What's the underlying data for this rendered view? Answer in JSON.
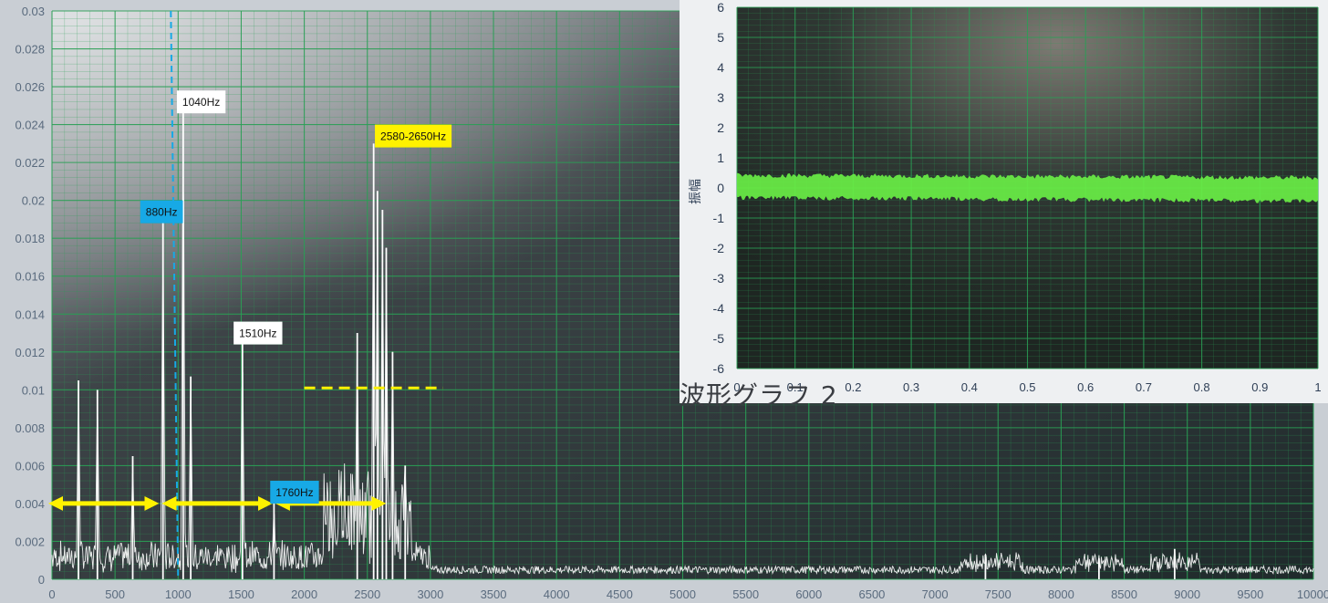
{
  "chart_data": [
    {
      "type": "line",
      "title": "",
      "xlabel": "",
      "ylabel": "",
      "xlim": [
        0,
        10000
      ],
      "ylim": [
        0,
        0.03
      ],
      "grid": true,
      "x_ticks": [
        "0",
        "500",
        "1000",
        "1500",
        "2000",
        "2500",
        "3000",
        "3500",
        "4000",
        "4500",
        "5000",
        "5500",
        "6000",
        "6500",
        "7000",
        "7500",
        "8000",
        "8500",
        "9000",
        "9500",
        "10000"
      ],
      "y_ticks": [
        "0",
        "0.002",
        "0.004",
        "0.006",
        "0.008",
        "0.01",
        "0.012",
        "0.014",
        "0.016",
        "0.018",
        "0.02",
        "0.022",
        "0.024",
        "0.026",
        "0.028",
        "0.03"
      ],
      "peaks": [
        {
          "x": 210,
          "y": 0.0105
        },
        {
          "x": 360,
          "y": 0.01
        },
        {
          "x": 640,
          "y": 0.0065
        },
        {
          "x": 880,
          "y": 0.019
        },
        {
          "x": 1040,
          "y": 0.025
        },
        {
          "x": 1100,
          "y": 0.0107
        },
        {
          "x": 1510,
          "y": 0.0127
        },
        {
          "x": 1760,
          "y": 0.004
        },
        {
          "x": 2420,
          "y": 0.013
        },
        {
          "x": 2550,
          "y": 0.023
        },
        {
          "x": 2580,
          "y": 0.0205
        },
        {
          "x": 2620,
          "y": 0.0195
        },
        {
          "x": 2650,
          "y": 0.0175
        },
        {
          "x": 2700,
          "y": 0.012
        },
        {
          "x": 2800,
          "y": 0.006
        },
        {
          "x": 7400,
          "y": 0.0013
        },
        {
          "x": 8300,
          "y": 0.0011
        },
        {
          "x": 8900,
          "y": 0.0016
        }
      ],
      "annotations": [
        {
          "text": "880Hz",
          "x": 700,
          "y": 0.02,
          "style": "blue"
        },
        {
          "text": "1040Hz",
          "x": 990,
          "y": 0.0258,
          "style": "white"
        },
        {
          "text": "1510Hz",
          "x": 1440,
          "y": 0.0136,
          "style": "white"
        },
        {
          "text": "1760Hz",
          "x": 1730,
          "y": 0.0052,
          "style": "blue"
        },
        {
          "text": "2580-2650Hz",
          "x": 2560,
          "y": 0.024,
          "style": "yellow"
        }
      ],
      "dashed_vertical_at_x": 1000,
      "dashed_horizontal": {
        "y": 0.0101,
        "x_from": 2000,
        "x_to": 3100
      },
      "ranges": [
        [
          0,
          820
        ],
        [
          900,
          1720
        ],
        [
          1800,
          2620
        ]
      ]
    },
    {
      "type": "line",
      "title": "波形グラフ 2",
      "ylabel": "振幅",
      "xlim": [
        0,
        1
      ],
      "ylim": [
        -6,
        6
      ],
      "grid": true,
      "x_ticks": [
        "0",
        "0.1",
        "0.2",
        "0.3",
        "0.4",
        "0.5",
        "0.6",
        "0.7",
        "0.8",
        "0.9",
        "1"
      ],
      "y_ticks": [
        "6",
        "5",
        "4",
        "3",
        "2",
        "1",
        "0",
        "-1",
        "-2",
        "-3",
        "-4",
        "-5",
        "-6"
      ],
      "band": {
        "center": 0.05,
        "amplitude": 0.45
      }
    }
  ],
  "colors": {
    "grid": "#2a9f55",
    "trace": "#ffffff",
    "wave": "#69ee45",
    "yellow": "#fff200",
    "blue_label": "#17a9e6"
  }
}
